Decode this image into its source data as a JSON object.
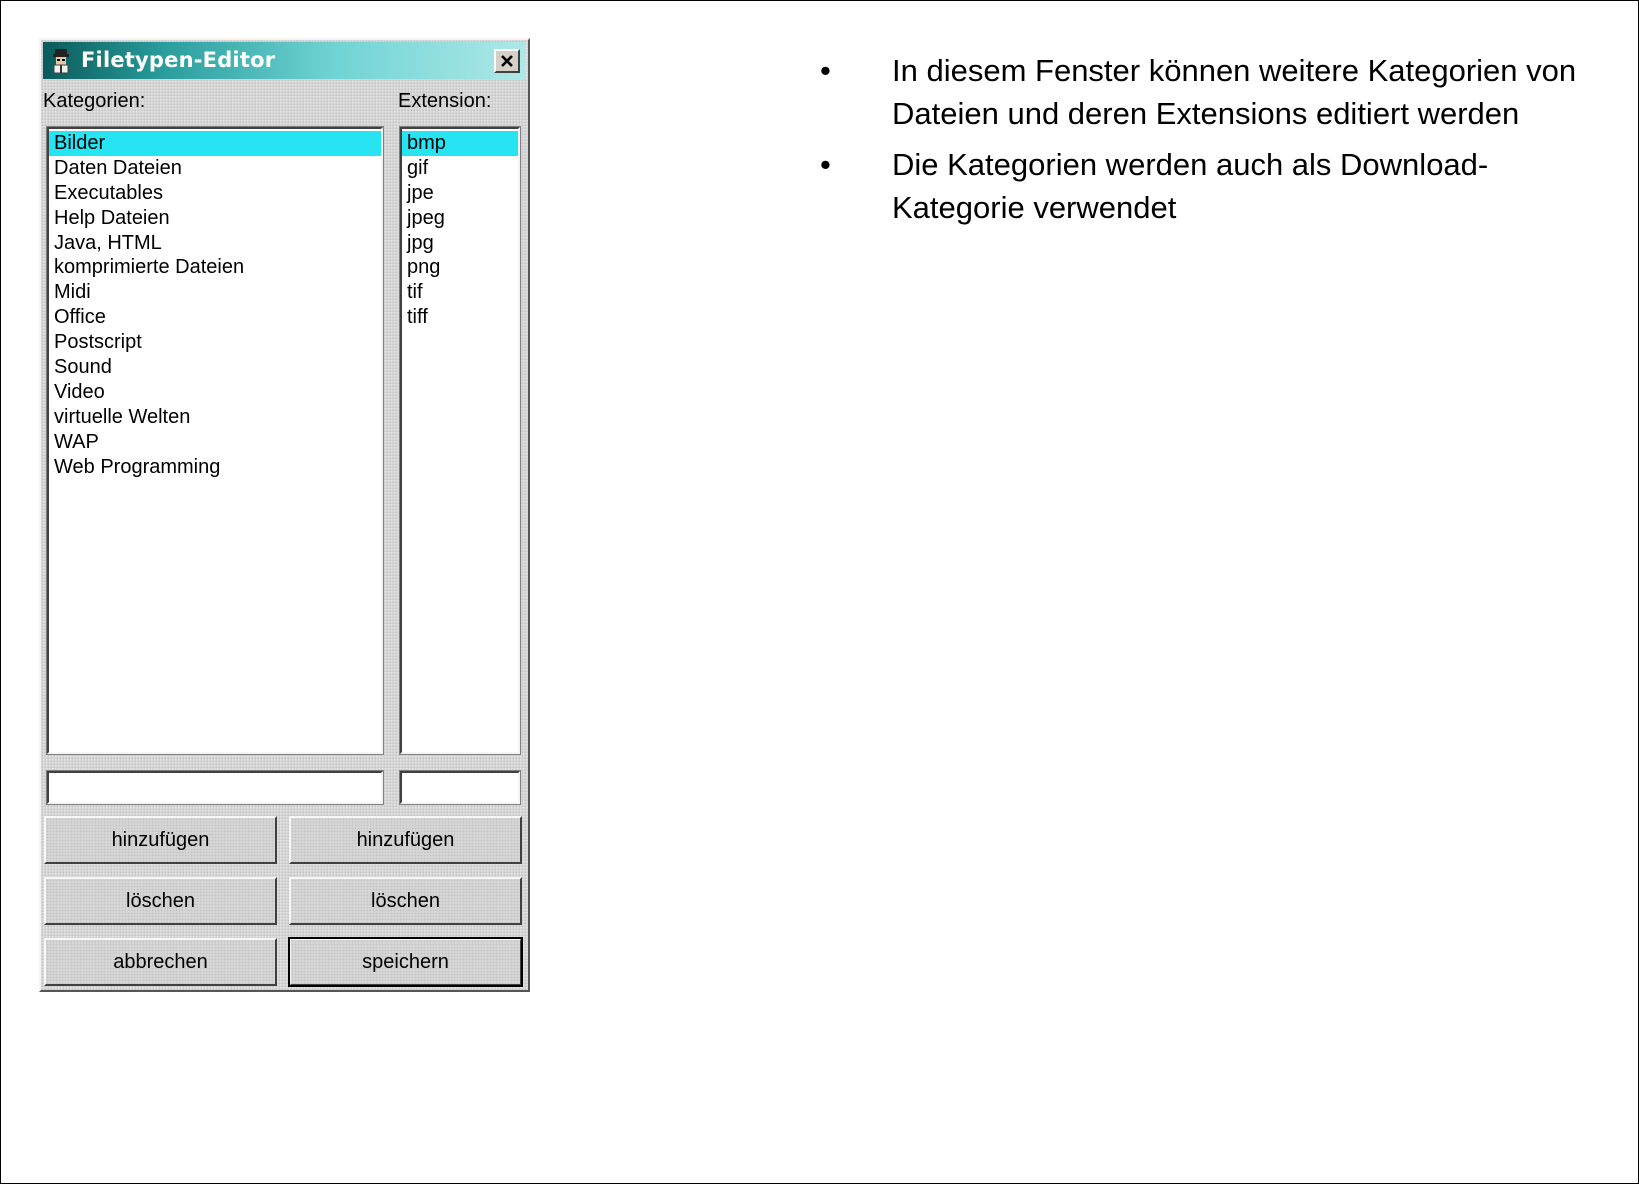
{
  "dialog": {
    "title": "Filetypen-Editor",
    "categories_label": "Kategorien:",
    "extension_label": "Extension:",
    "categories": [
      "Bilder",
      "Daten Dateien",
      "Executables",
      "Help Dateien",
      "Java, HTML",
      "komprimierte Dateien",
      "Midi",
      "Office",
      "Postscript",
      "Sound",
      "Video",
      "virtuelle Welten",
      "WAP",
      "Web Programming"
    ],
    "selected_category": "Bilder",
    "extensions": [
      "bmp",
      "gif",
      "jpe",
      "jpeg",
      "jpg",
      "png",
      "tif",
      "tiff"
    ],
    "selected_extension": "bmp",
    "category_input_value": "",
    "extension_input_value": "",
    "buttons": {
      "add_category": "hinzufügen",
      "add_extension": "hinzufügen",
      "delete_category": "löschen",
      "delete_extension": "löschen",
      "cancel": "abbrechen",
      "save": "speichern"
    },
    "colors": {
      "selection": "#26e4f2",
      "titlebar_start": "#0a5a5a",
      "titlebar_end": "#aee8e8"
    }
  },
  "bullets": {
    "marker": "•",
    "items": [
      "In diesem Fenster können weitere Kategorien von Dateien und deren Extensions editiert werden",
      "Die Kategorien werden auch als Download-Kategorie verwendet"
    ]
  }
}
